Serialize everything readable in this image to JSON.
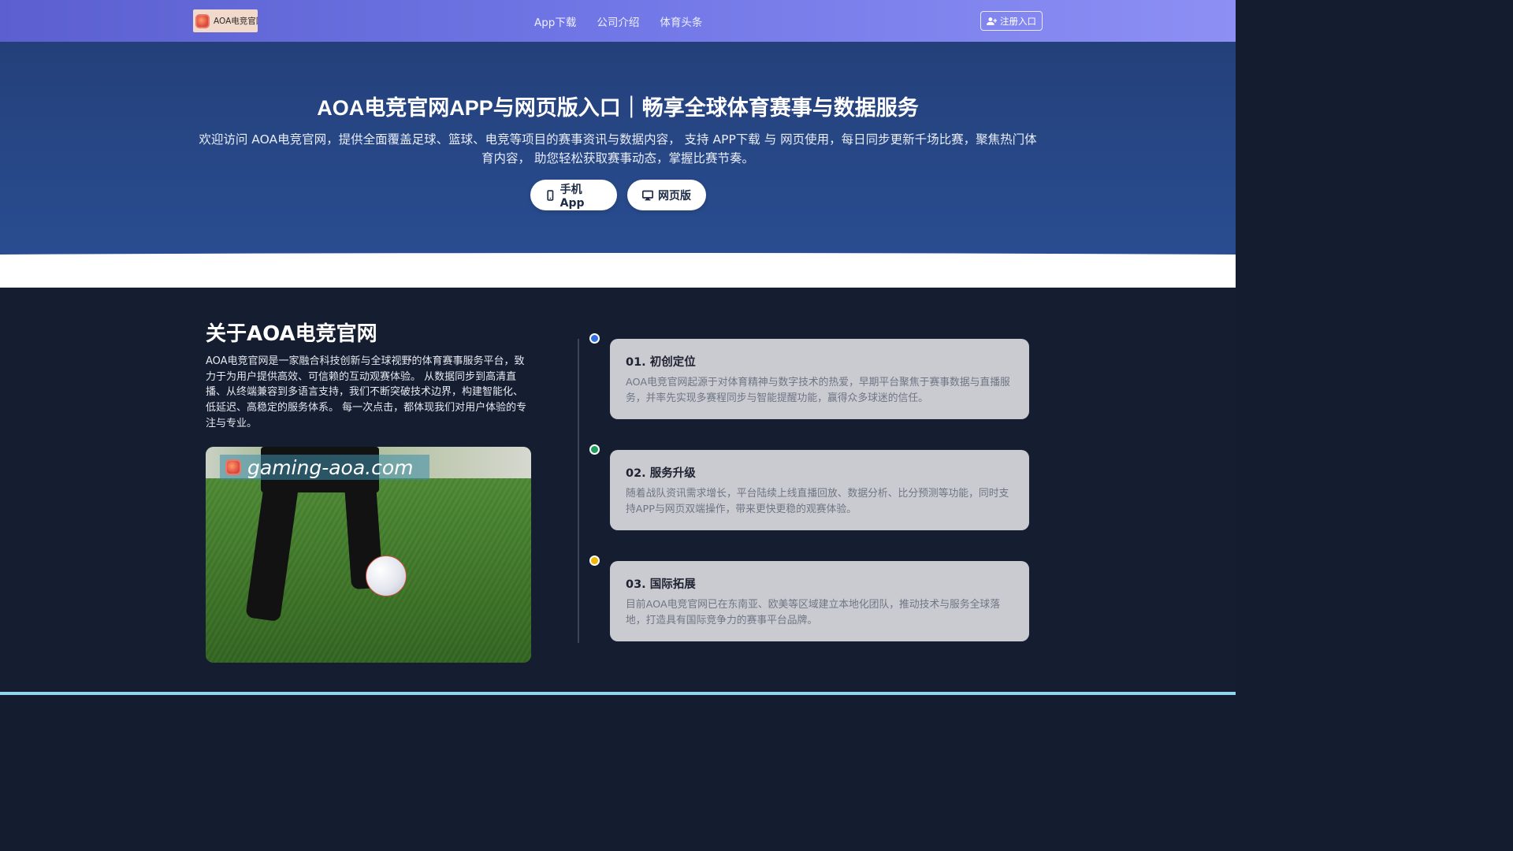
{
  "nav": {
    "logo_text": "AOA电竞官网",
    "links": [
      "App下载",
      "公司介绍",
      "体育头条"
    ],
    "register_label": "注册入口"
  },
  "hero": {
    "title": "AOA电竞官网APP与网页版入口｜畅享全球体育赛事与数据服务",
    "description": "欢迎访问 AOA电竞官网，提供全面覆盖足球、篮球、电竞等项目的赛事资讯与数据内容， 支持 APP下载 与 网页使用，每日同步更新千场比赛，聚焦热门体育内容， 助您轻松获取赛事动态，掌握比赛节奏。",
    "buttons": {
      "app_label": "手机App",
      "web_label": "网页版"
    }
  },
  "about": {
    "title": "关于AOA电竞官网",
    "text": "AOA电竞官网是一家融合科技创新与全球视野的体育赛事服务平台，致力于为用户提供高效、可信赖的互动观赛体验。 从数据同步到高清直播、从终端兼容到多语言支持，我们不断突破技术边界，构建智能化、低延迟、高稳定的服务体系。 每一次点击，都体现我们对用户体验的专注与专业。",
    "image_watermark": "gaming-aoa.com"
  },
  "timeline": [
    {
      "title": "01. 初创定位",
      "text": "AOA电竞官网起源于对体育精神与数字技术的热爱，早期平台聚焦于赛事数据与直播服务，并率先实现多赛程同步与智能提醒功能，赢得众多球迷的信任。",
      "dot_color": "#2f6fe0"
    },
    {
      "title": "02. 服务升级",
      "text": "随着战队资讯需求增长，平台陆续上线直播回放、数据分析、比分预测等功能，同时支持APP与网页双端操作，带来更快更稳的观赛体验。",
      "dot_color": "#1f9d5a"
    },
    {
      "title": "03. 国际拓展",
      "text": "目前AOA电竞官网已在东南亚、欧美等区域建立本地化团队，推动技术与服务全球落地，打造具有国际竞争力的赛事平台品牌。",
      "dot_color": "#f2b705"
    }
  ]
}
